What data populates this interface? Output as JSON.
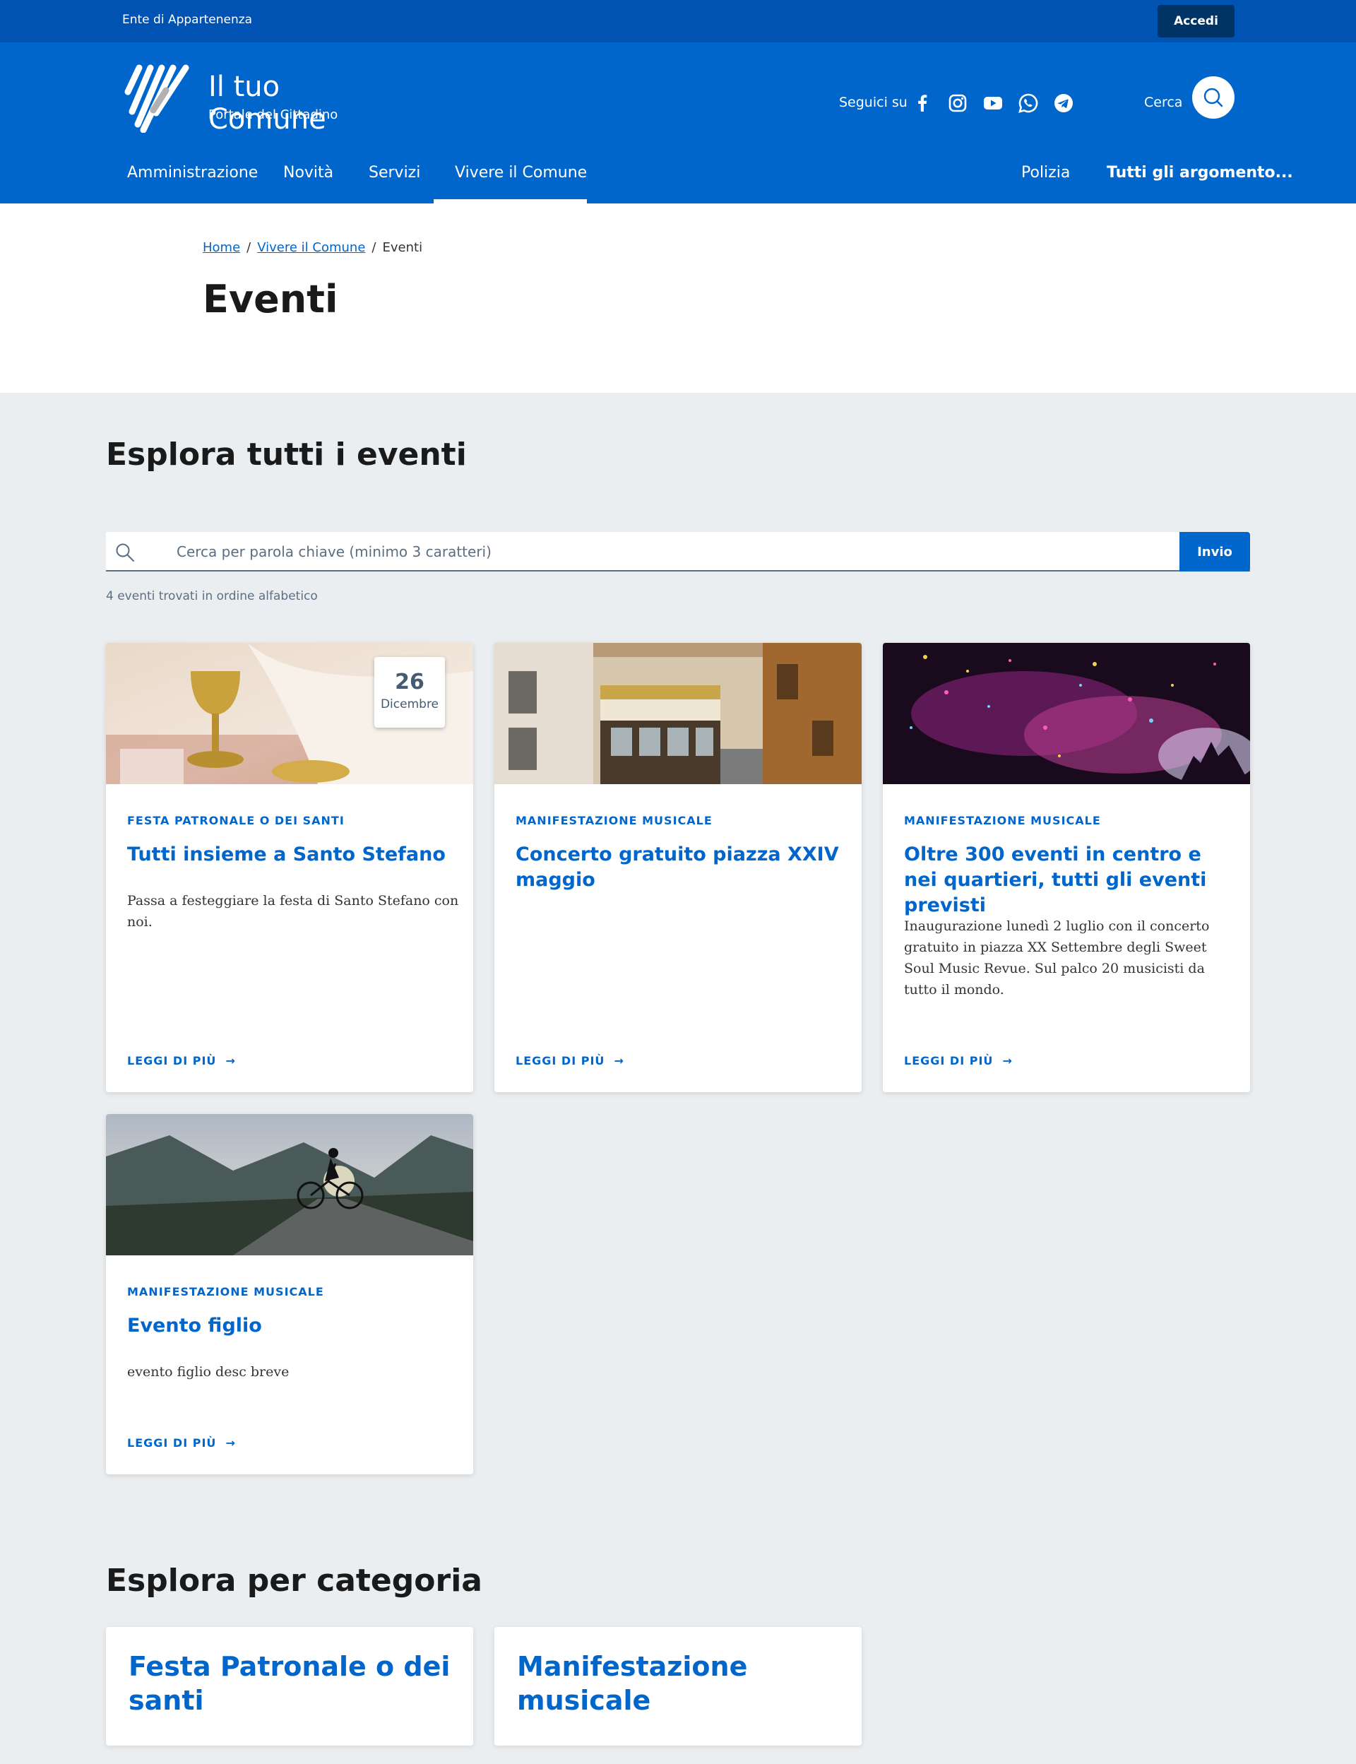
{
  "slim_header": {
    "ente": "Ente di Appartenenza",
    "login_label": "Accedi"
  },
  "brand": {
    "title": "Il tuo Comune",
    "tagline": "Portale del Cittadino"
  },
  "social": {
    "label": "Seguici su",
    "icons": [
      "facebook-icon",
      "instagram-icon",
      "youtube-icon",
      "whatsapp-icon",
      "telegram-icon"
    ]
  },
  "search_header": {
    "label": "Cerca"
  },
  "nav": {
    "items": [
      "Amministrazione",
      "Novità",
      "Servizi",
      "Vivere il Comune"
    ],
    "secondary": [
      "Polizia",
      "Tutti gli argomento..."
    ],
    "active": "Vivere il Comune"
  },
  "breadcrumb": {
    "home": "Home",
    "parent": "Vivere il Comune",
    "current": "Eventi",
    "separator": "/"
  },
  "page_title": "Eventi",
  "explore": {
    "title": "Esplora tutti i eventi",
    "search_placeholder": "Cerca per parola chiave (minimo 3 caratteri)",
    "search_value": "",
    "submit_label": "Invio",
    "results_text": "4 eventi trovati in ordine alfabetico"
  },
  "cards": [
    {
      "category": "FESTA PATRONALE O DEI SANTI",
      "title": "Tutti insieme a Santo Stefano",
      "description": "Passa a festeggiare la festa di Santo Stefano con noi.",
      "date_day": "26",
      "date_month": "Dicembre",
      "more": "LEGGI DI PIÙ"
    },
    {
      "category": "MANIFESTAZIONE MUSICALE",
      "title": "Concerto gratuito piazza XXIV maggio",
      "description": "",
      "more": "LEGGI DI PIÙ"
    },
    {
      "category": "MANIFESTAZIONE MUSICALE",
      "title": "Oltre 300 eventi in centro e nei quartieri, tutti gli eventi previsti",
      "description": "Inaugurazione lunedì 2 luglio con il concerto gratuito in piazza XX Settembre degli Sweet Soul Music Revue. Sul palco 20 musicisti da tutto il mondo.",
      "more": "LEGGI DI PIÙ"
    },
    {
      "category": "MANIFESTAZIONE MUSICALE",
      "title": "Evento figlio",
      "description": "evento figlio desc breve",
      "more": "LEGGI DI PIÙ"
    }
  ],
  "categories": {
    "title": "Esplora per categoria",
    "items": [
      "Festa Patronale o dei santi",
      "Manifestazione musicale"
    ]
  },
  "colors": {
    "primary": "#0066cc",
    "slim": "#0053b3",
    "login": "#003366",
    "background": "#ebeef0"
  }
}
